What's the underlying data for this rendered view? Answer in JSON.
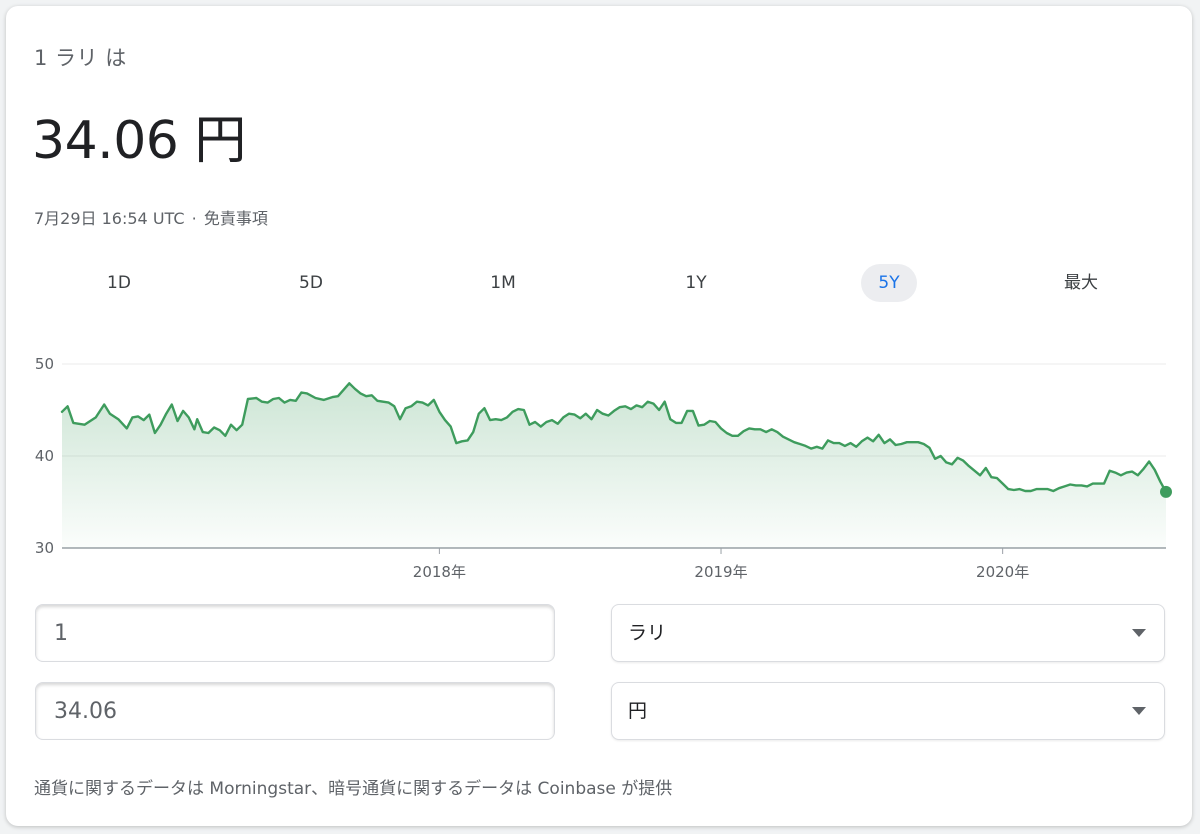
{
  "header": {
    "subtitle": "1 ラリ は",
    "rate": "34.06 円",
    "timestamp": "7月29日 16:54 UTC",
    "separator": "·",
    "disclaimer": "免責事項"
  },
  "tabs": [
    {
      "label": "1D",
      "active": false
    },
    {
      "label": "5D",
      "active": false
    },
    {
      "label": "1M",
      "active": false
    },
    {
      "label": "1Y",
      "active": false
    },
    {
      "label": "5Y",
      "active": true
    },
    {
      "label": "最大",
      "active": false
    }
  ],
  "colors": {
    "line": "#3e9c5d",
    "accent": "#1a73e8"
  },
  "chart_data": {
    "type": "area",
    "ylim": [
      30,
      50
    ],
    "yticks": [
      {
        "label": "50",
        "value": 50
      },
      {
        "label": "40",
        "value": 40
      },
      {
        "label": "30",
        "value": 30
      }
    ],
    "xlim": [
      2016.66,
      2020.58
    ],
    "xticks": [
      {
        "label": "2018年",
        "value": 2018.0
      },
      {
        "label": "2019年",
        "value": 2019.0
      },
      {
        "label": "2020年",
        "value": 2020.0
      }
    ],
    "series": [
      {
        "points": [
          [
            2016.66,
            44.8
          ],
          [
            2016.68,
            45.4
          ],
          [
            2016.7,
            43.6
          ],
          [
            2016.74,
            43.4
          ],
          [
            2016.78,
            44.2
          ],
          [
            2016.81,
            45.6
          ],
          [
            2016.83,
            44.6
          ],
          [
            2016.86,
            44.0
          ],
          [
            2016.89,
            43.0
          ],
          [
            2016.91,
            44.2
          ],
          [
            2016.93,
            44.3
          ],
          [
            2016.95,
            43.9
          ],
          [
            2016.97,
            44.5
          ],
          [
            2016.99,
            42.5
          ],
          [
            2017.01,
            43.4
          ],
          [
            2017.03,
            44.6
          ],
          [
            2017.05,
            45.6
          ],
          [
            2017.07,
            43.8
          ],
          [
            2017.09,
            44.9
          ],
          [
            2017.11,
            44.2
          ],
          [
            2017.13,
            42.9
          ],
          [
            2017.14,
            44.0
          ],
          [
            2017.16,
            42.6
          ],
          [
            2017.18,
            42.5
          ],
          [
            2017.2,
            43.1
          ],
          [
            2017.22,
            42.8
          ],
          [
            2017.24,
            42.2
          ],
          [
            2017.26,
            43.4
          ],
          [
            2017.28,
            42.8
          ],
          [
            2017.3,
            43.4
          ],
          [
            2017.32,
            46.2
          ],
          [
            2017.35,
            46.3
          ],
          [
            2017.37,
            45.9
          ],
          [
            2017.39,
            45.8
          ],
          [
            2017.41,
            46.2
          ],
          [
            2017.43,
            46.3
          ],
          [
            2017.45,
            45.8
          ],
          [
            2017.47,
            46.1
          ],
          [
            2017.49,
            46.0
          ],
          [
            2017.51,
            46.9
          ],
          [
            2017.53,
            46.8
          ],
          [
            2017.56,
            46.3
          ],
          [
            2017.59,
            46.1
          ],
          [
            2017.62,
            46.4
          ],
          [
            2017.64,
            46.5
          ],
          [
            2017.66,
            47.2
          ],
          [
            2017.68,
            47.9
          ],
          [
            2017.7,
            47.3
          ],
          [
            2017.72,
            46.8
          ],
          [
            2017.74,
            46.5
          ],
          [
            2017.76,
            46.6
          ],
          [
            2017.78,
            46.0
          ],
          [
            2017.8,
            45.9
          ],
          [
            2017.82,
            45.8
          ],
          [
            2017.84,
            45.4
          ],
          [
            2017.86,
            44.0
          ],
          [
            2017.88,
            45.2
          ],
          [
            2017.9,
            45.4
          ],
          [
            2017.92,
            45.9
          ],
          [
            2017.94,
            45.8
          ],
          [
            2017.96,
            45.5
          ],
          [
            2017.98,
            46.1
          ],
          [
            2018.0,
            44.8
          ],
          [
            2018.02,
            43.9
          ],
          [
            2018.04,
            43.2
          ],
          [
            2018.06,
            41.4
          ],
          [
            2018.08,
            41.6
          ],
          [
            2018.1,
            41.7
          ],
          [
            2018.12,
            42.6
          ],
          [
            2018.14,
            44.6
          ],
          [
            2018.16,
            45.2
          ],
          [
            2018.18,
            43.9
          ],
          [
            2018.2,
            44.0
          ],
          [
            2018.22,
            43.9
          ],
          [
            2018.24,
            44.2
          ],
          [
            2018.26,
            44.8
          ],
          [
            2018.28,
            45.1
          ],
          [
            2018.3,
            45.0
          ],
          [
            2018.32,
            43.4
          ],
          [
            2018.34,
            43.7
          ],
          [
            2018.36,
            43.2
          ],
          [
            2018.38,
            43.7
          ],
          [
            2018.4,
            43.9
          ],
          [
            2018.42,
            43.5
          ],
          [
            2018.44,
            44.2
          ],
          [
            2018.46,
            44.6
          ],
          [
            2018.48,
            44.5
          ],
          [
            2018.5,
            44.1
          ],
          [
            2018.52,
            44.6
          ],
          [
            2018.54,
            44.0
          ],
          [
            2018.56,
            45.0
          ],
          [
            2018.58,
            44.6
          ],
          [
            2018.6,
            44.4
          ],
          [
            2018.62,
            44.9
          ],
          [
            2018.64,
            45.3
          ],
          [
            2018.66,
            45.4
          ],
          [
            2018.68,
            45.1
          ],
          [
            2018.7,
            45.5
          ],
          [
            2018.72,
            45.3
          ],
          [
            2018.74,
            45.9
          ],
          [
            2018.76,
            45.7
          ],
          [
            2018.78,
            45.0
          ],
          [
            2018.8,
            45.9
          ],
          [
            2018.82,
            44.0
          ],
          [
            2018.84,
            43.6
          ],
          [
            2018.86,
            43.6
          ],
          [
            2018.88,
            44.9
          ],
          [
            2018.9,
            44.9
          ],
          [
            2018.92,
            43.3
          ],
          [
            2018.94,
            43.4
          ],
          [
            2018.96,
            43.8
          ],
          [
            2018.98,
            43.7
          ],
          [
            2019.0,
            43.0
          ],
          [
            2019.02,
            42.5
          ],
          [
            2019.04,
            42.2
          ],
          [
            2019.06,
            42.2
          ],
          [
            2019.08,
            42.7
          ],
          [
            2019.1,
            43.0
          ],
          [
            2019.12,
            42.9
          ],
          [
            2019.14,
            42.9
          ],
          [
            2019.16,
            42.6
          ],
          [
            2019.18,
            42.9
          ],
          [
            2019.2,
            42.6
          ],
          [
            2019.22,
            42.1
          ],
          [
            2019.24,
            41.8
          ],
          [
            2019.26,
            41.5
          ],
          [
            2019.28,
            41.3
          ],
          [
            2019.3,
            41.1
          ],
          [
            2019.32,
            40.8
          ],
          [
            2019.34,
            41.0
          ],
          [
            2019.36,
            40.8
          ],
          [
            2019.38,
            41.7
          ],
          [
            2019.4,
            41.4
          ],
          [
            2019.42,
            41.4
          ],
          [
            2019.44,
            41.1
          ],
          [
            2019.46,
            41.4
          ],
          [
            2019.48,
            41.0
          ],
          [
            2019.5,
            41.6
          ],
          [
            2019.52,
            42.0
          ],
          [
            2019.54,
            41.6
          ],
          [
            2019.56,
            42.3
          ],
          [
            2019.58,
            41.4
          ],
          [
            2019.6,
            41.8
          ],
          [
            2019.62,
            41.2
          ],
          [
            2019.64,
            41.3
          ],
          [
            2019.66,
            41.5
          ],
          [
            2019.68,
            41.5
          ],
          [
            2019.7,
            41.5
          ],
          [
            2019.72,
            41.3
          ],
          [
            2019.74,
            40.9
          ],
          [
            2019.76,
            39.7
          ],
          [
            2019.78,
            40.0
          ],
          [
            2019.8,
            39.3
          ],
          [
            2019.82,
            39.1
          ],
          [
            2019.84,
            39.8
          ],
          [
            2019.86,
            39.5
          ],
          [
            2019.88,
            38.9
          ],
          [
            2019.9,
            38.4
          ],
          [
            2019.92,
            37.9
          ],
          [
            2019.94,
            38.7
          ],
          [
            2019.96,
            37.7
          ],
          [
            2019.98,
            37.6
          ],
          [
            2020.0,
            37.0
          ],
          [
            2020.02,
            36.4
          ],
          [
            2020.04,
            36.3
          ],
          [
            2020.06,
            36.4
          ],
          [
            2020.08,
            36.2
          ],
          [
            2020.1,
            36.2
          ],
          [
            2020.12,
            36.4
          ],
          [
            2020.14,
            36.4
          ],
          [
            2020.16,
            36.4
          ],
          [
            2020.18,
            36.2
          ],
          [
            2020.2,
            36.5
          ],
          [
            2020.22,
            36.7
          ],
          [
            2020.24,
            36.9
          ],
          [
            2020.26,
            36.8
          ],
          [
            2020.28,
            36.8
          ],
          [
            2020.3,
            36.7
          ],
          [
            2020.32,
            37.0
          ],
          [
            2020.34,
            37.0
          ],
          [
            2020.36,
            37.0
          ],
          [
            2020.38,
            38.4
          ],
          [
            2020.4,
            38.2
          ],
          [
            2020.42,
            37.9
          ],
          [
            2020.44,
            38.2
          ],
          [
            2020.46,
            38.3
          ],
          [
            2020.48,
            37.9
          ],
          [
            2020.5,
            38.6
          ],
          [
            2020.52,
            39.4
          ],
          [
            2020.54,
            38.5
          ],
          [
            2020.56,
            37.2
          ],
          [
            2020.58,
            36.1
          ]
        ]
      }
    ]
  },
  "converter": {
    "from_value": "1",
    "from_currency": "ラリ",
    "to_value": "34.06",
    "to_currency": "円"
  },
  "source": "通貨に関するデータは Morningstar、暗号通貨に関するデータは Coinbase が提供"
}
